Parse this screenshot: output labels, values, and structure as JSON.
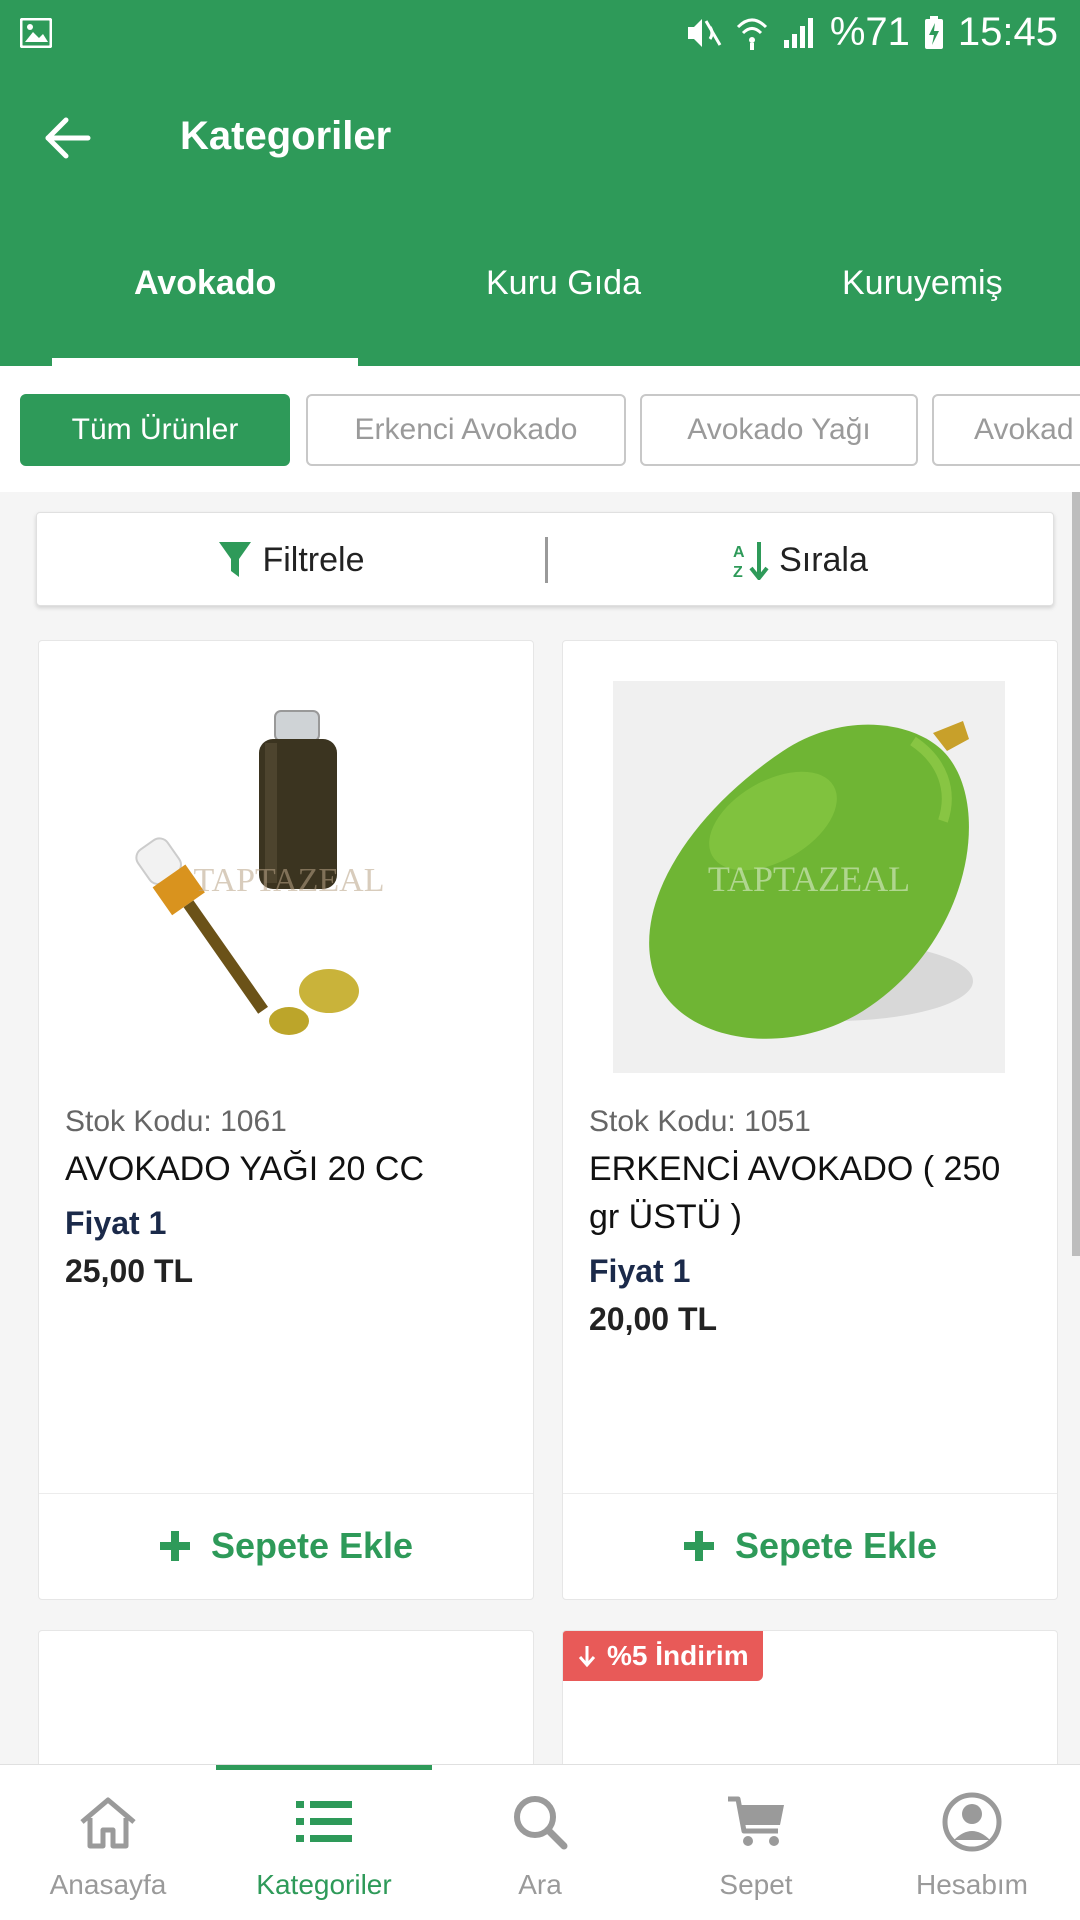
{
  "status_bar": {
    "battery": "%71",
    "time": "15:45",
    "icons": [
      "gallery-icon",
      "mute-vibrate-icon",
      "wifi-icon",
      "signal-icon",
      "battery-charging-icon"
    ]
  },
  "app_bar": {
    "title": "Kategoriler",
    "back_icon": "arrow-left-icon"
  },
  "category_tabs": [
    {
      "label": "Avokado",
      "active": true
    },
    {
      "label": "Kuru Gıda",
      "active": false
    },
    {
      "label": "Kuruyemiş",
      "active": false
    }
  ],
  "sub_chips": [
    {
      "label": "Tüm Ürünler",
      "active": true
    },
    {
      "label": "Erkenci Avokado",
      "active": false
    },
    {
      "label": "Avokado Yağı",
      "active": false
    },
    {
      "label": "Avokad",
      "active": false
    }
  ],
  "toolbar": {
    "filter_label": "Filtrele",
    "sort_label": "Sırala"
  },
  "products": [
    {
      "stock_code": "Stok Kodu: 1061",
      "name": "AVOKADO YAĞI  20 CC",
      "price_label": "Fiyat 1",
      "price": "25,00 TL",
      "add_label": "Sepete Ekle",
      "watermark": "TAPTAZEAL"
    },
    {
      "stock_code": "Stok Kodu: 1051",
      "name": "ERKENCİ AVOKADO ( 250 gr ÜSTÜ )",
      "price_label": "Fiyat 1",
      "price": "20,00 TL",
      "add_label": "Sepete Ekle",
      "watermark": "TAPTAZEAL"
    },
    {
      "discount": null
    },
    {
      "discount": "%5 İndirim"
    }
  ],
  "bottom_nav": [
    {
      "label": "Anasayfa",
      "icon": "home-icon",
      "active": false
    },
    {
      "label": "Kategoriler",
      "icon": "list-icon",
      "active": true
    },
    {
      "label": "Ara",
      "icon": "search-icon",
      "active": false
    },
    {
      "label": "Sepet",
      "icon": "cart-icon",
      "active": false
    },
    {
      "label": "Hesabım",
      "icon": "account-icon",
      "active": false
    }
  ],
  "colors": {
    "primary": "#2e9a59",
    "discount": "#e85a58",
    "price_label": "#1b2a4a"
  }
}
